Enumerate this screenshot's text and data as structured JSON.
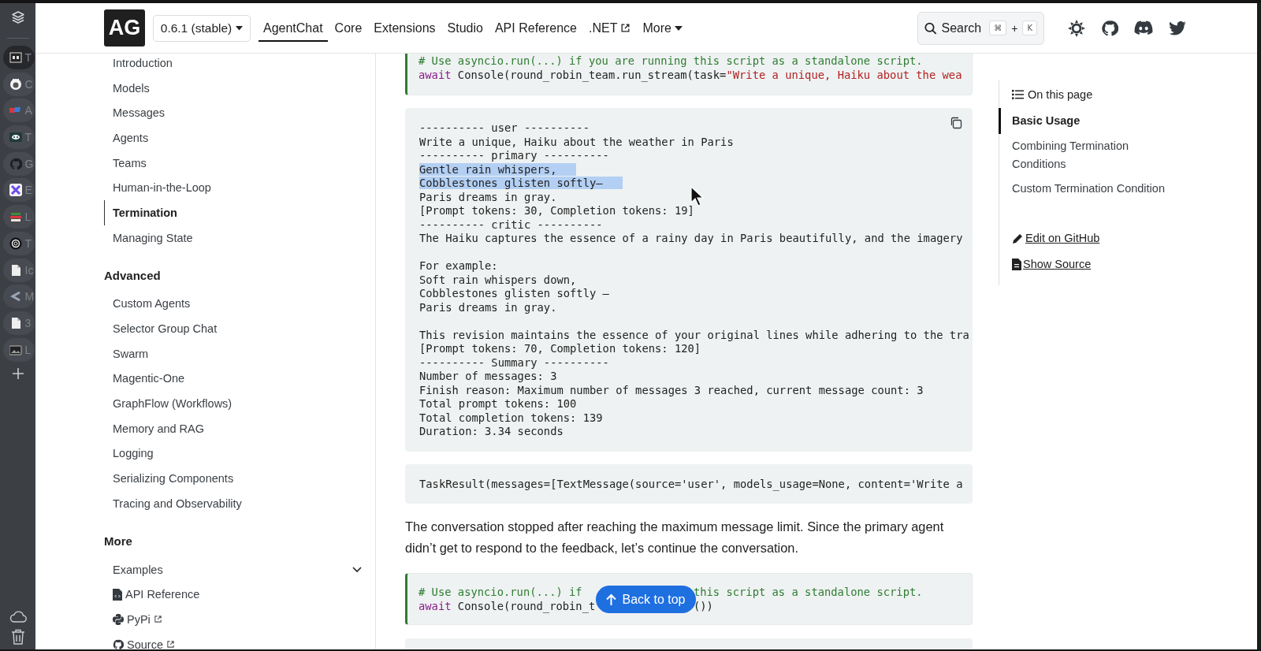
{
  "app_rail": {
    "tabs": [
      {
        "label": "T",
        "selected": true
      },
      {
        "label": "C",
        "selected": false
      },
      {
        "label": "A",
        "selected": false
      },
      {
        "label": "T",
        "selected": false
      },
      {
        "label": "G",
        "selected": false
      },
      {
        "label": "E",
        "selected": false
      },
      {
        "label": "L",
        "selected": false
      },
      {
        "label": "T",
        "selected": false
      },
      {
        "label": "Ic",
        "selected": false
      },
      {
        "label": "M",
        "selected": false
      },
      {
        "label": "3",
        "selected": false
      },
      {
        "label": "L",
        "selected": false
      }
    ]
  },
  "header": {
    "logo": "AG",
    "version": "0.6.1 (stable)",
    "nav": [
      {
        "label": "AgentChat",
        "selected": true
      },
      {
        "label": "Core",
        "selected": false
      },
      {
        "label": "Extensions",
        "selected": false
      },
      {
        "label": "Studio",
        "selected": false
      },
      {
        "label": "API Reference",
        "selected": false
      },
      {
        "label": ".NET",
        "selected": false,
        "external": true
      },
      {
        "label": "More",
        "selected": false,
        "menu": true
      }
    ],
    "search": {
      "label": "Search",
      "keys": [
        {
          "kind": "key",
          "text": "⌘"
        },
        {
          "kind": "plus",
          "text": "+"
        },
        {
          "kind": "key",
          "text": "K"
        }
      ]
    }
  },
  "sidebar": {
    "sections": [
      {
        "items": [
          {
            "label": "Introduction",
            "selected": false
          },
          {
            "label": "Models",
            "selected": false
          },
          {
            "label": "Messages",
            "selected": false
          },
          {
            "label": "Agents",
            "selected": false
          },
          {
            "label": "Teams",
            "selected": false
          },
          {
            "label": "Human-in-the-Loop",
            "selected": false
          },
          {
            "label": "Termination",
            "selected": true
          },
          {
            "label": "Managing State",
            "selected": false
          }
        ]
      },
      {
        "title": "Advanced",
        "items": [
          {
            "label": "Custom Agents",
            "selected": false
          },
          {
            "label": "Selector Group Chat",
            "selected": false
          },
          {
            "label": "Swarm",
            "selected": false
          },
          {
            "label": "Magentic-One",
            "selected": false
          },
          {
            "label": "GraphFlow (Workflows)",
            "selected": false
          },
          {
            "label": "Memory and RAG",
            "selected": false
          },
          {
            "label": "Logging",
            "selected": false
          },
          {
            "label": "Serializing Components",
            "selected": false
          },
          {
            "label": "Tracing and Observability",
            "selected": false
          }
        ]
      },
      {
        "title": "More",
        "items": [
          {
            "label": "Examples",
            "selected": false,
            "expanded": false
          },
          {
            "label": "API Reference",
            "selected": false,
            "external": false
          },
          {
            "label": "PyPi",
            "selected": false,
            "external": true
          },
          {
            "label": "Source",
            "selected": false,
            "external": true
          }
        ]
      }
    ]
  },
  "content": {
    "blocks": [
      {
        "kind": "input",
        "lines": [
          {
            "segments": [
              {
                "kind": "comment",
                "text": "# Use asyncio.run(...) if you are running this script as a standalone script."
              }
            ]
          },
          {
            "segments": [
              {
                "kind": "keyword",
                "text": "await"
              },
              {
                "kind": "plain",
                "text": " Console(round_robin_team.run_stream(task="
              },
              {
                "kind": "string",
                "text": "\"Write a unique, Haiku about the wea"
              }
            ]
          }
        ]
      },
      {
        "kind": "output",
        "copy_button": true,
        "lines": [
          {
            "text": "---------- user ----------",
            "selected": false
          },
          {
            "text": "Write a unique, Haiku about the weather in Paris",
            "selected": false
          },
          {
            "text": "---------- primary ----------",
            "selected": false
          },
          {
            "text": "Gentle rain whispers,",
            "selected": true
          },
          {
            "text": "Cobblestones glisten softly—",
            "selected": true
          },
          {
            "text": "Paris dreams in gray.",
            "selected": false
          },
          {
            "text": "[Prompt tokens: 30, Completion tokens: 19]",
            "selected": false
          },
          {
            "text": "---------- critic ----------",
            "selected": false
          },
          {
            "text": "The Haiku captures the essence of a rainy day in Paris beautifully, and the imagery",
            "selected": false
          },
          {
            "selected": false
          },
          {
            "text": "For example:",
            "selected": false
          },
          {
            "text": "Soft rain whispers down,",
            "selected": false
          },
          {
            "text": "Cobblestones glisten softly —",
            "selected": false
          },
          {
            "text": "Paris dreams in gray.",
            "selected": false
          },
          {
            "selected": false
          },
          {
            "text": "This revision maintains the essence of your original lines while adhering to the tra",
            "selected": false
          },
          {
            "text": "[Prompt tokens: 70, Completion tokens: 120]",
            "selected": false
          },
          {
            "text": "---------- Summary ----------",
            "selected": false
          },
          {
            "text": "Number of messages: 3",
            "selected": false
          },
          {
            "text": "Finish reason: Maximum number of messages 3 reached, current message count: 3",
            "selected": false
          },
          {
            "text": "Total prompt tokens: 100",
            "selected": false
          },
          {
            "text": "Total completion tokens: 139",
            "selected": false
          },
          {
            "text": "Duration: 3.34 seconds",
            "selected": false
          }
        ]
      },
      {
        "kind": "output",
        "copy_button": false,
        "lines": [
          {
            "text": "TaskResult(messages=[TextMessage(source='user', models_usage=None, content='Write a",
            "selected": false
          }
        ]
      },
      {
        "kind": "paragraph",
        "text": "The conversation stopped after reaching the maximum message limit. Since the primary agent didn’t get to respond to the feedback, let’s continue the conversation."
      },
      {
        "kind": "input",
        "lines": [
          {
            "segments": [
              {
                "kind": "comment",
                "text": "# Use asyncio.run(...) if"
              },
              {
                "kind": "covered"
              },
              {
                "kind": "comment",
                "text": "this script as a standalone script."
              }
            ]
          },
          {
            "segments": [
              {
                "kind": "keyword",
                "text": "await"
              },
              {
                "kind": "plain",
                "text": " Console(round_robin_t"
              },
              {
                "kind": "covered"
              },
              {
                "kind": "plain",
                "text": "())"
              }
            ]
          }
        ]
      },
      {
        "kind": "output",
        "copy_button": false
      }
    ],
    "back_to_top": "Back to top"
  },
  "toc": {
    "title": "On this page",
    "items": [
      {
        "label": "Basic Usage",
        "selected": true
      },
      {
        "label": "Combining Termination Conditions",
        "selected": false
      },
      {
        "label": "Custom Termination Condition",
        "selected": false
      }
    ],
    "links": [
      {
        "kind": "edit",
        "label": "Edit on GitHub"
      },
      {
        "kind": "source",
        "label": "Show Source"
      }
    ]
  }
}
